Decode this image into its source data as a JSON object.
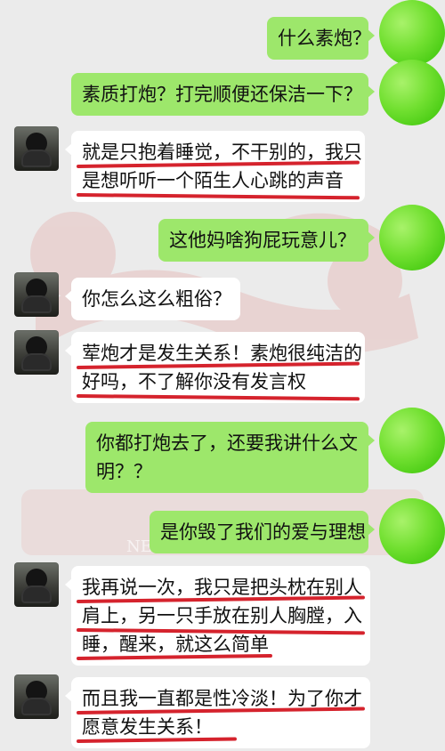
{
  "colors": {
    "background": "#ebebeb",
    "incoming_bubble": "#ffffff",
    "outgoing_bubble": "#9de76b",
    "outgoing_avatar": "#5bd11f",
    "underline": "#d5232d",
    "watermark_red": "#d83a34"
  },
  "messages": [
    {
      "sender": "self",
      "lines": [
        "什么素炮？"
      ]
    },
    {
      "sender": "self",
      "lines": [
        "素质打炮？打完顺便还保洁一下？"
      ]
    },
    {
      "sender": "other",
      "lines": [
        "就是只抱着睡觉，不干别的，我只",
        "是想听听一个陌生人心跳的声音"
      ]
    },
    {
      "sender": "self",
      "lines": [
        "这他妈啥狗屁玩意儿？"
      ]
    },
    {
      "sender": "other",
      "lines": [
        "你怎么这么粗俗？"
      ]
    },
    {
      "sender": "other",
      "lines": [
        "荤炮才是发生关系！素炮很纯洁的",
        "好吗，不了解你没有发言权"
      ]
    },
    {
      "sender": "self",
      "lines": [
        "你都打炮去了，还要我讲什么文",
        "明？？"
      ]
    },
    {
      "sender": "self",
      "lines": [
        "是你毁了我们的爱与理想"
      ]
    },
    {
      "sender": "other",
      "lines": [
        "我再说一次，我只是把头枕在别人",
        "肩上，另一只手放在别人胸膛，入",
        "睡，醒来，就这么简单"
      ]
    },
    {
      "sender": "other",
      "lines": [
        "而且我一直都是性冷淡！为了你才",
        "愿意发生关系！"
      ]
    }
  ],
  "watermark": {
    "text": "NEW YOUTH SALON"
  }
}
